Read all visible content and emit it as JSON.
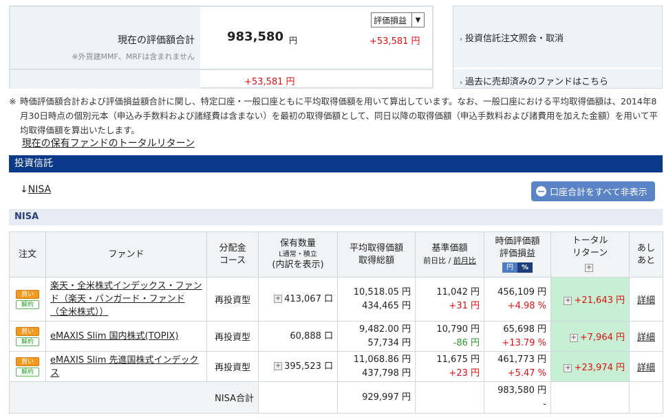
{
  "summary": {
    "current_label": "現在の評価額合計",
    "note": "※外貨建MMF、MRFは含まれません",
    "current_value": "983,580",
    "unit": "円",
    "gain": "+53,581 円",
    "select_value": "評価損益",
    "total_return_label": "現在の保有ファンドのトータルリターン",
    "total_return_value": "+53,581 円"
  },
  "side_links": {
    "order_inquiry": "投資信託注文照会・取消",
    "sold_funds": "過去に売却済みのファンドはこちら"
  },
  "note": {
    "mark": "※",
    "text": "時価評価額合計および評価損益額合計に関し、特定口座・一般口座ともに平均取得価額を用いて算出しています。なお、一般口座における平均取得価額は、2014年8月30日時点の個別元本（申込み手数料および諸経費は含まない）を最初の取得価額として、同日以降の取得価額（申込手数料および諸費用を加えた金額）を用いて平均取得価額を算出いたします。"
  },
  "section": {
    "title": "投資信託",
    "jump_arrow": "↓",
    "jump_link": "NISA",
    "hide_button": "口座合計をすべて非表示",
    "band": "NISA"
  },
  "table": {
    "headers": {
      "order": "注文",
      "fund": "ファンド",
      "dist_1": "分配金",
      "dist_2": "コース",
      "qty_1": "保有数量",
      "qty_sub": "L通常・積立",
      "qty_2": "(内訳を表示)",
      "avg_1": "平均取得価額",
      "avg_2": "取得総額",
      "base_1": "基準価額",
      "base_sub_a": "前日比",
      "base_sub_sep": " / ",
      "base_sub_b": "前月比",
      "eval_1": "時価評価額",
      "eval_2": "評価損益",
      "toggle_yen": "円",
      "toggle_pct": "%",
      "ret_1": "トータル",
      "ret_2": "リターン",
      "ashi_1": "あし",
      "ashi_2": "あと"
    },
    "buy_label": "買い",
    "sell_label": "解約",
    "rows": [
      {
        "fund": "楽天・全米株式インデックス・ファンド（楽天・バンガード・ファンド（全米株式））",
        "course": "再投資型",
        "qty": "413,067 口",
        "avg_price": "10,518.05 円",
        "total_cost": "434,465 円",
        "base_price": "11,042 円",
        "change": "+31 円",
        "eval": "456,109 円",
        "eval_pl": "+4.98 %",
        "total_return": "+21,643 円",
        "detail": "詳細"
      },
      {
        "fund": "eMAXIS Slim 国内株式(TOPIX)",
        "course": "再投資型",
        "qty": "60,888 口",
        "avg_price": "9,482.00 円",
        "total_cost": "57,734 円",
        "base_price": "10,790 円",
        "change": "-86 円",
        "eval": "65,698 円",
        "eval_pl": "+13.79 %",
        "total_return": "+7,964 円",
        "detail": "詳細"
      },
      {
        "fund": "eMAXIS Slim 先進国株式インデックス",
        "course": "再投資型",
        "qty": "395,523 口",
        "avg_price": "11,068.86 円",
        "total_cost": "437,798 円",
        "base_price": "11,675 円",
        "change": "+23 円",
        "eval": "461,773 円",
        "eval_pl": "+5.47 %",
        "total_return": "+23,974 円",
        "detail": "詳細"
      }
    ],
    "total": {
      "label": "NISA合計",
      "total_cost": "929,997 円",
      "eval": "983,580 円",
      "eval_pl": "-"
    }
  },
  "colors": {
    "header_bar": "#0b3a8a",
    "gain_red": "#e01010",
    "loss_green": "#2a9a2a",
    "return_bg": "#c6efd4",
    "button_blue": "#5b84c6"
  }
}
